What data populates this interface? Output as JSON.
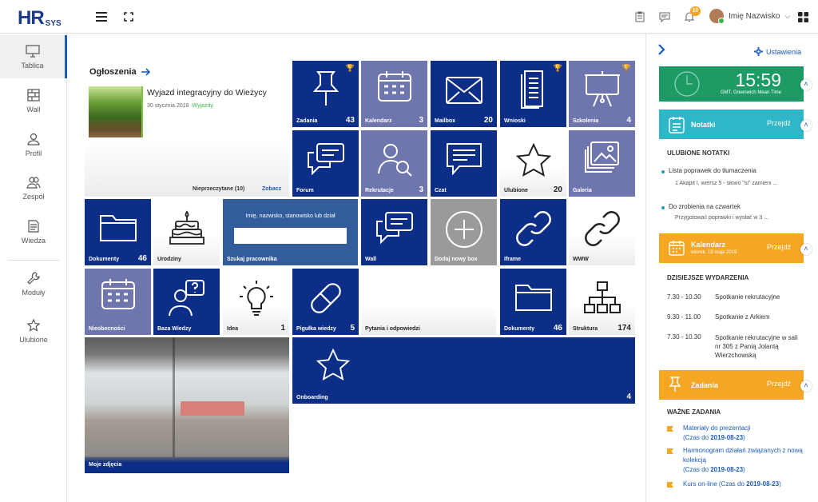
{
  "app": {
    "logo_main": "HR",
    "logo_sub": "SYS"
  },
  "user": {
    "name": "Imię Nazwisko",
    "notifications": "10"
  },
  "sidebar": {
    "items": [
      {
        "label": "Tablica",
        "icon": "monitor-icon"
      },
      {
        "label": "Wall",
        "icon": "wall-icon"
      },
      {
        "label": "Profil",
        "icon": "user-icon"
      },
      {
        "label": "Zespół",
        "icon": "team-icon"
      },
      {
        "label": "Wiedza",
        "icon": "document-icon"
      },
      {
        "label": "Moduły",
        "icon": "wrench-icon"
      },
      {
        "label": "Ulubione",
        "icon": "star-icon"
      }
    ]
  },
  "announcements": {
    "title": "Ogłoszenia",
    "headline": "Wyjazd integracyjny do Wieżycy",
    "date": "30 stycznia 2018",
    "category": "Wyjazdy",
    "unread": "Nieprzeczytane (10)",
    "see": "Zobacz"
  },
  "tiles": {
    "zadania": {
      "label": "Zadania",
      "count": "43"
    },
    "kalendarz": {
      "label": "Kalendarz",
      "count": "3"
    },
    "mailbox": {
      "label": "Mailbox",
      "count": "20"
    },
    "wnioski": {
      "label": "Wnioski",
      "count": ""
    },
    "szkolenia": {
      "label": "Szkolenia",
      "count": "4"
    },
    "forum": {
      "label": "Forum",
      "count": ""
    },
    "rekrutacje": {
      "label": "Rekrutacje",
      "count": "3"
    },
    "czat": {
      "label": "Czat",
      "count": ""
    },
    "ulubione": {
      "label": "Ulubione",
      "count": "20"
    },
    "galeria": {
      "label": "Galeria",
      "count": ""
    },
    "dokumenty": {
      "label": "Dokumenty",
      "count": "46"
    },
    "urodziny": {
      "label": "Urodziny",
      "count": ""
    },
    "szukaj": {
      "label": "Szukaj pracownika",
      "hint": "Imię, nazwisko, stanowisko lub dział"
    },
    "wall": {
      "label": "Wall",
      "count": ""
    },
    "dodaj": {
      "label": "Dodaj nowy box"
    },
    "iframe": {
      "label": "Iframe"
    },
    "www": {
      "label": "WWW"
    },
    "nieobecnosci": {
      "label": "Nieobecności"
    },
    "bazawiedzy": {
      "label": "Baza Wiedzy"
    },
    "idea": {
      "label": "Idea",
      "count": "1"
    },
    "pigulka": {
      "label": "Pigułka wiedzy",
      "count": "5"
    },
    "pytania": {
      "label": "Pytania i odpowiedzi"
    },
    "dokumenty2": {
      "label": "Dokumenty",
      "count": "46"
    },
    "struktura": {
      "label": "Struktura",
      "count": "174"
    },
    "zdjecia": {
      "label": "Moje zdjęcia"
    },
    "onboarding": {
      "label": "Onboarding",
      "count": "4"
    }
  },
  "right": {
    "settings": "Ustawienia",
    "time": "15:59",
    "timezone": "GMT, Greenwich Mean Time",
    "notes": {
      "title": "Notatki",
      "go": "Przejdź",
      "heading": "ULUBIONE NOTATKI",
      "items": [
        {
          "title": "Lista poprawek do tłumaczenia",
          "text": "1 Akapit I, wiersz 5 - słowo \"si\" zamieni ..."
        },
        {
          "title": "Do zrobienia na czwartek",
          "text": "Przygotować poprawki i wysłać w 3 ..."
        }
      ]
    },
    "calendar": {
      "title": "Kalendarz",
      "subtitle": "wtorek, 19 maja 2019",
      "go": "Przejdź",
      "heading": "DZISIEJSZE WYDARZENIA",
      "events": [
        {
          "time": "7.30 - 10.30",
          "text": "Spotkanie rekrutacyjne"
        },
        {
          "time": "9.30 - 11.00",
          "text": "Spotkanie z Arkiem"
        },
        {
          "time": "7.30 - 10.30",
          "text": "Spotkanie rekrutacyjne w sali nr 305 z Panią Jolantą Wierzchowską"
        }
      ]
    },
    "tasks": {
      "title": "Zadania",
      "go": "Przejdź",
      "heading": "WAŻNE ZADANIA",
      "items": [
        {
          "text": "Materiały do prezentacji",
          "due": "(Czas do ",
          "date": "2019-08-23",
          "end": ")"
        },
        {
          "text": "Harmonogram działań związanych z nową kolekcją",
          "due": "(Czas do ",
          "date": "2019-08-23",
          "end": ")"
        },
        {
          "text": "Kurs on-line (Czas do ",
          "date": "2019-08-23",
          "end": ")"
        }
      ]
    }
  },
  "colors": {
    "navy": "#0d2e86",
    "purple": "#6f76ae",
    "green": "#1c9b64",
    "teal": "#2fb6c9",
    "orange": "#f5a623"
  }
}
